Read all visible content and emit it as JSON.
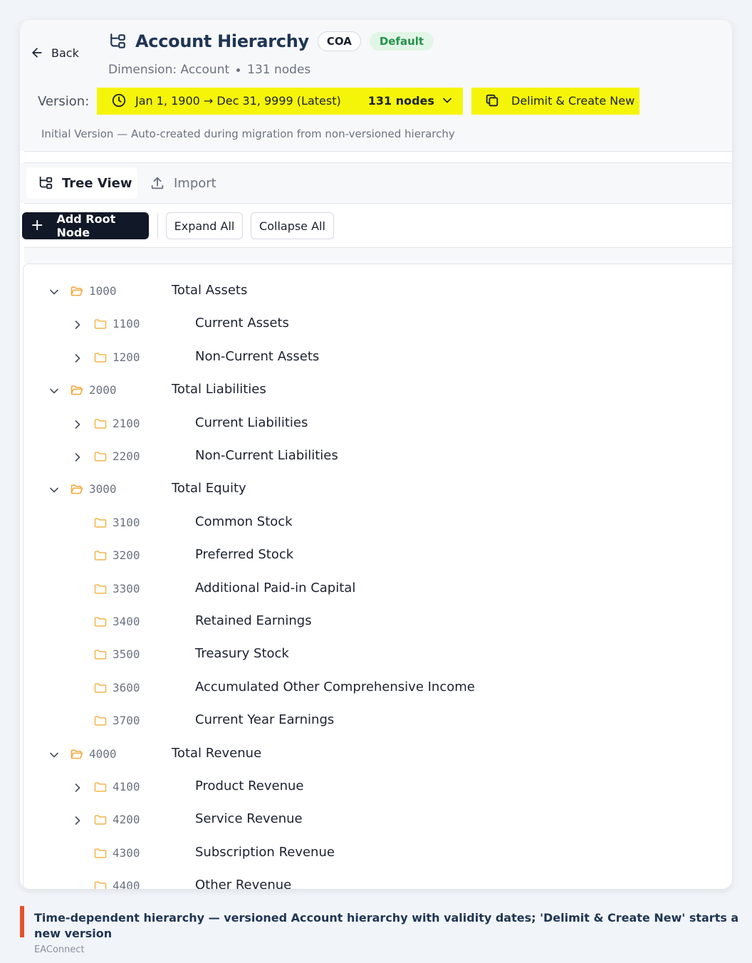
{
  "header": {
    "back_label": "Back",
    "title": "Account Hierarchy",
    "coa_badge": "COA",
    "default_badge": "Default",
    "dimension": "Dimension: Account",
    "node_count": "131 nodes"
  },
  "version": {
    "label": "Version:",
    "range": "Jan 1, 1900 → Dec 31, 9999 (Latest)",
    "nodes": "131 nodes",
    "delimit_label": "Delimit & Create New",
    "note": "Initial Version — Auto-created during migration from non-versioned hierarchy",
    "highlight_color": "#f5f50a"
  },
  "tabs": [
    {
      "label": "Tree View",
      "active": true
    },
    {
      "label": "Import",
      "active": false
    }
  ],
  "toolbar": {
    "add_root": "Add Root Node",
    "expand_all": "Expand All",
    "collapse_all": "Collapse All"
  },
  "tree": [
    {
      "code": "1000",
      "name": "Total Assets",
      "level": 0,
      "chevron": "down",
      "open": true
    },
    {
      "code": "1100",
      "name": "Current Assets",
      "level": 1,
      "chevron": "right",
      "open": false
    },
    {
      "code": "1200",
      "name": "Non-Current Assets",
      "level": 1,
      "chevron": "right",
      "open": false
    },
    {
      "code": "2000",
      "name": "Total Liabilities",
      "level": 0,
      "chevron": "down",
      "open": true
    },
    {
      "code": "2100",
      "name": "Current Liabilities",
      "level": 1,
      "chevron": "right",
      "open": false
    },
    {
      "code": "2200",
      "name": "Non-Current Liabilities",
      "level": 1,
      "chevron": "right",
      "open": false
    },
    {
      "code": "3000",
      "name": "Total Equity",
      "level": 0,
      "chevron": "down",
      "open": true
    },
    {
      "code": "3100",
      "name": "Common Stock",
      "level": 1,
      "chevron": "none",
      "open": false
    },
    {
      "code": "3200",
      "name": "Preferred Stock",
      "level": 1,
      "chevron": "none",
      "open": false
    },
    {
      "code": "3300",
      "name": "Additional Paid-in Capital",
      "level": 1,
      "chevron": "none",
      "open": false
    },
    {
      "code": "3400",
      "name": "Retained Earnings",
      "level": 1,
      "chevron": "none",
      "open": false
    },
    {
      "code": "3500",
      "name": "Treasury Stock",
      "level": 1,
      "chevron": "none",
      "open": false
    },
    {
      "code": "3600",
      "name": "Accumulated Other Comprehensive Income",
      "level": 1,
      "chevron": "none",
      "open": false
    },
    {
      "code": "3700",
      "name": "Current Year Earnings",
      "level": 1,
      "chevron": "none",
      "open": false
    },
    {
      "code": "4000",
      "name": "Total Revenue",
      "level": 0,
      "chevron": "down",
      "open": true
    },
    {
      "code": "4100",
      "name": "Product Revenue",
      "level": 1,
      "chevron": "right",
      "open": false
    },
    {
      "code": "4200",
      "name": "Service Revenue",
      "level": 1,
      "chevron": "right",
      "open": false
    },
    {
      "code": "4300",
      "name": "Subscription Revenue",
      "level": 1,
      "chevron": "none",
      "open": false
    },
    {
      "code": "4400",
      "name": "Other Revenue",
      "level": 1,
      "chevron": "none",
      "open": false
    }
  ],
  "colors": {
    "folder_open": "#f0a63a",
    "folder_closed": "#f2b54a",
    "accent_badge": "#26924a",
    "caption_bar": "#e4512b"
  },
  "caption": {
    "text": "Time-dependent hierarchy — versioned Account hierarchy with validity dates; 'Delimit & Create New' starts a new version",
    "source": "EAConnect"
  }
}
